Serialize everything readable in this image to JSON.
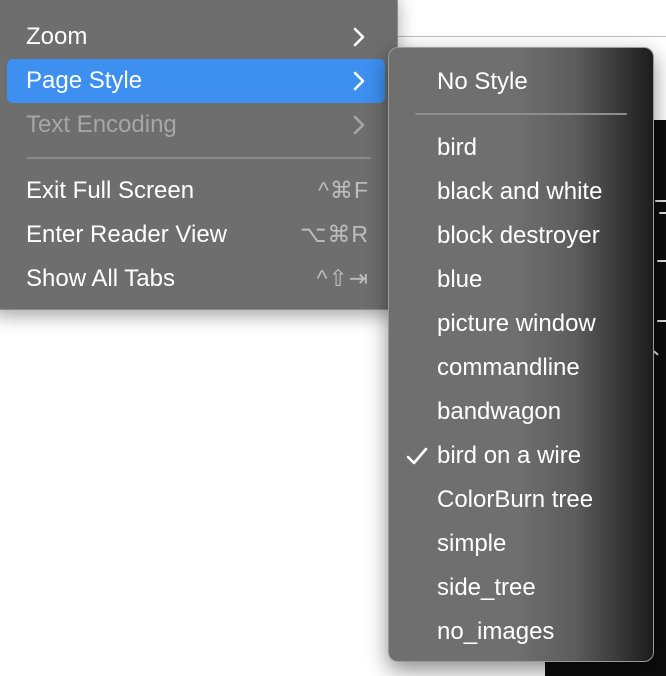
{
  "main_menu": {
    "items": [
      {
        "label": "Zoom",
        "shortcut": "",
        "submenu": true,
        "selected": false,
        "disabled": false
      },
      {
        "label": "Page Style",
        "shortcut": "",
        "submenu": true,
        "selected": true,
        "disabled": false
      },
      {
        "label": "Text Encoding",
        "shortcut": "",
        "submenu": true,
        "selected": false,
        "disabled": true
      },
      {
        "label": "Exit Full Screen",
        "shortcut": "^⌘F",
        "submenu": false,
        "selected": false,
        "disabled": false
      },
      {
        "label": "Enter Reader View",
        "shortcut": "⌥⌘R",
        "submenu": false,
        "selected": false,
        "disabled": false
      },
      {
        "label": "Show All Tabs",
        "shortcut": "^⇧⇥",
        "submenu": false,
        "selected": false,
        "disabled": false
      }
    ]
  },
  "page_style_submenu": {
    "header_item": "No Style",
    "styles": [
      {
        "label": "bird",
        "checked": false
      },
      {
        "label": "black and white",
        "checked": false
      },
      {
        "label": "block destroyer",
        "checked": false
      },
      {
        "label": "blue",
        "checked": false
      },
      {
        "label": "picture window",
        "checked": false
      },
      {
        "label": "commandline",
        "checked": false
      },
      {
        "label": "bandwagon",
        "checked": false
      },
      {
        "label": "bird on a wire",
        "checked": true
      },
      {
        "label": "ColorBurn tree",
        "checked": false
      },
      {
        "label": "simple",
        "checked": false
      },
      {
        "label": "side_tree",
        "checked": false
      },
      {
        "label": "no_images",
        "checked": false
      }
    ]
  },
  "colors": {
    "selection": "#3d8ff0",
    "menu_bg": "#6e6e6e",
    "text": "#ffffff",
    "disabled_text": "#a6a6a6"
  },
  "icons": {
    "submenu_arrow": "chevron-right-icon",
    "check": "checkmark-icon"
  }
}
